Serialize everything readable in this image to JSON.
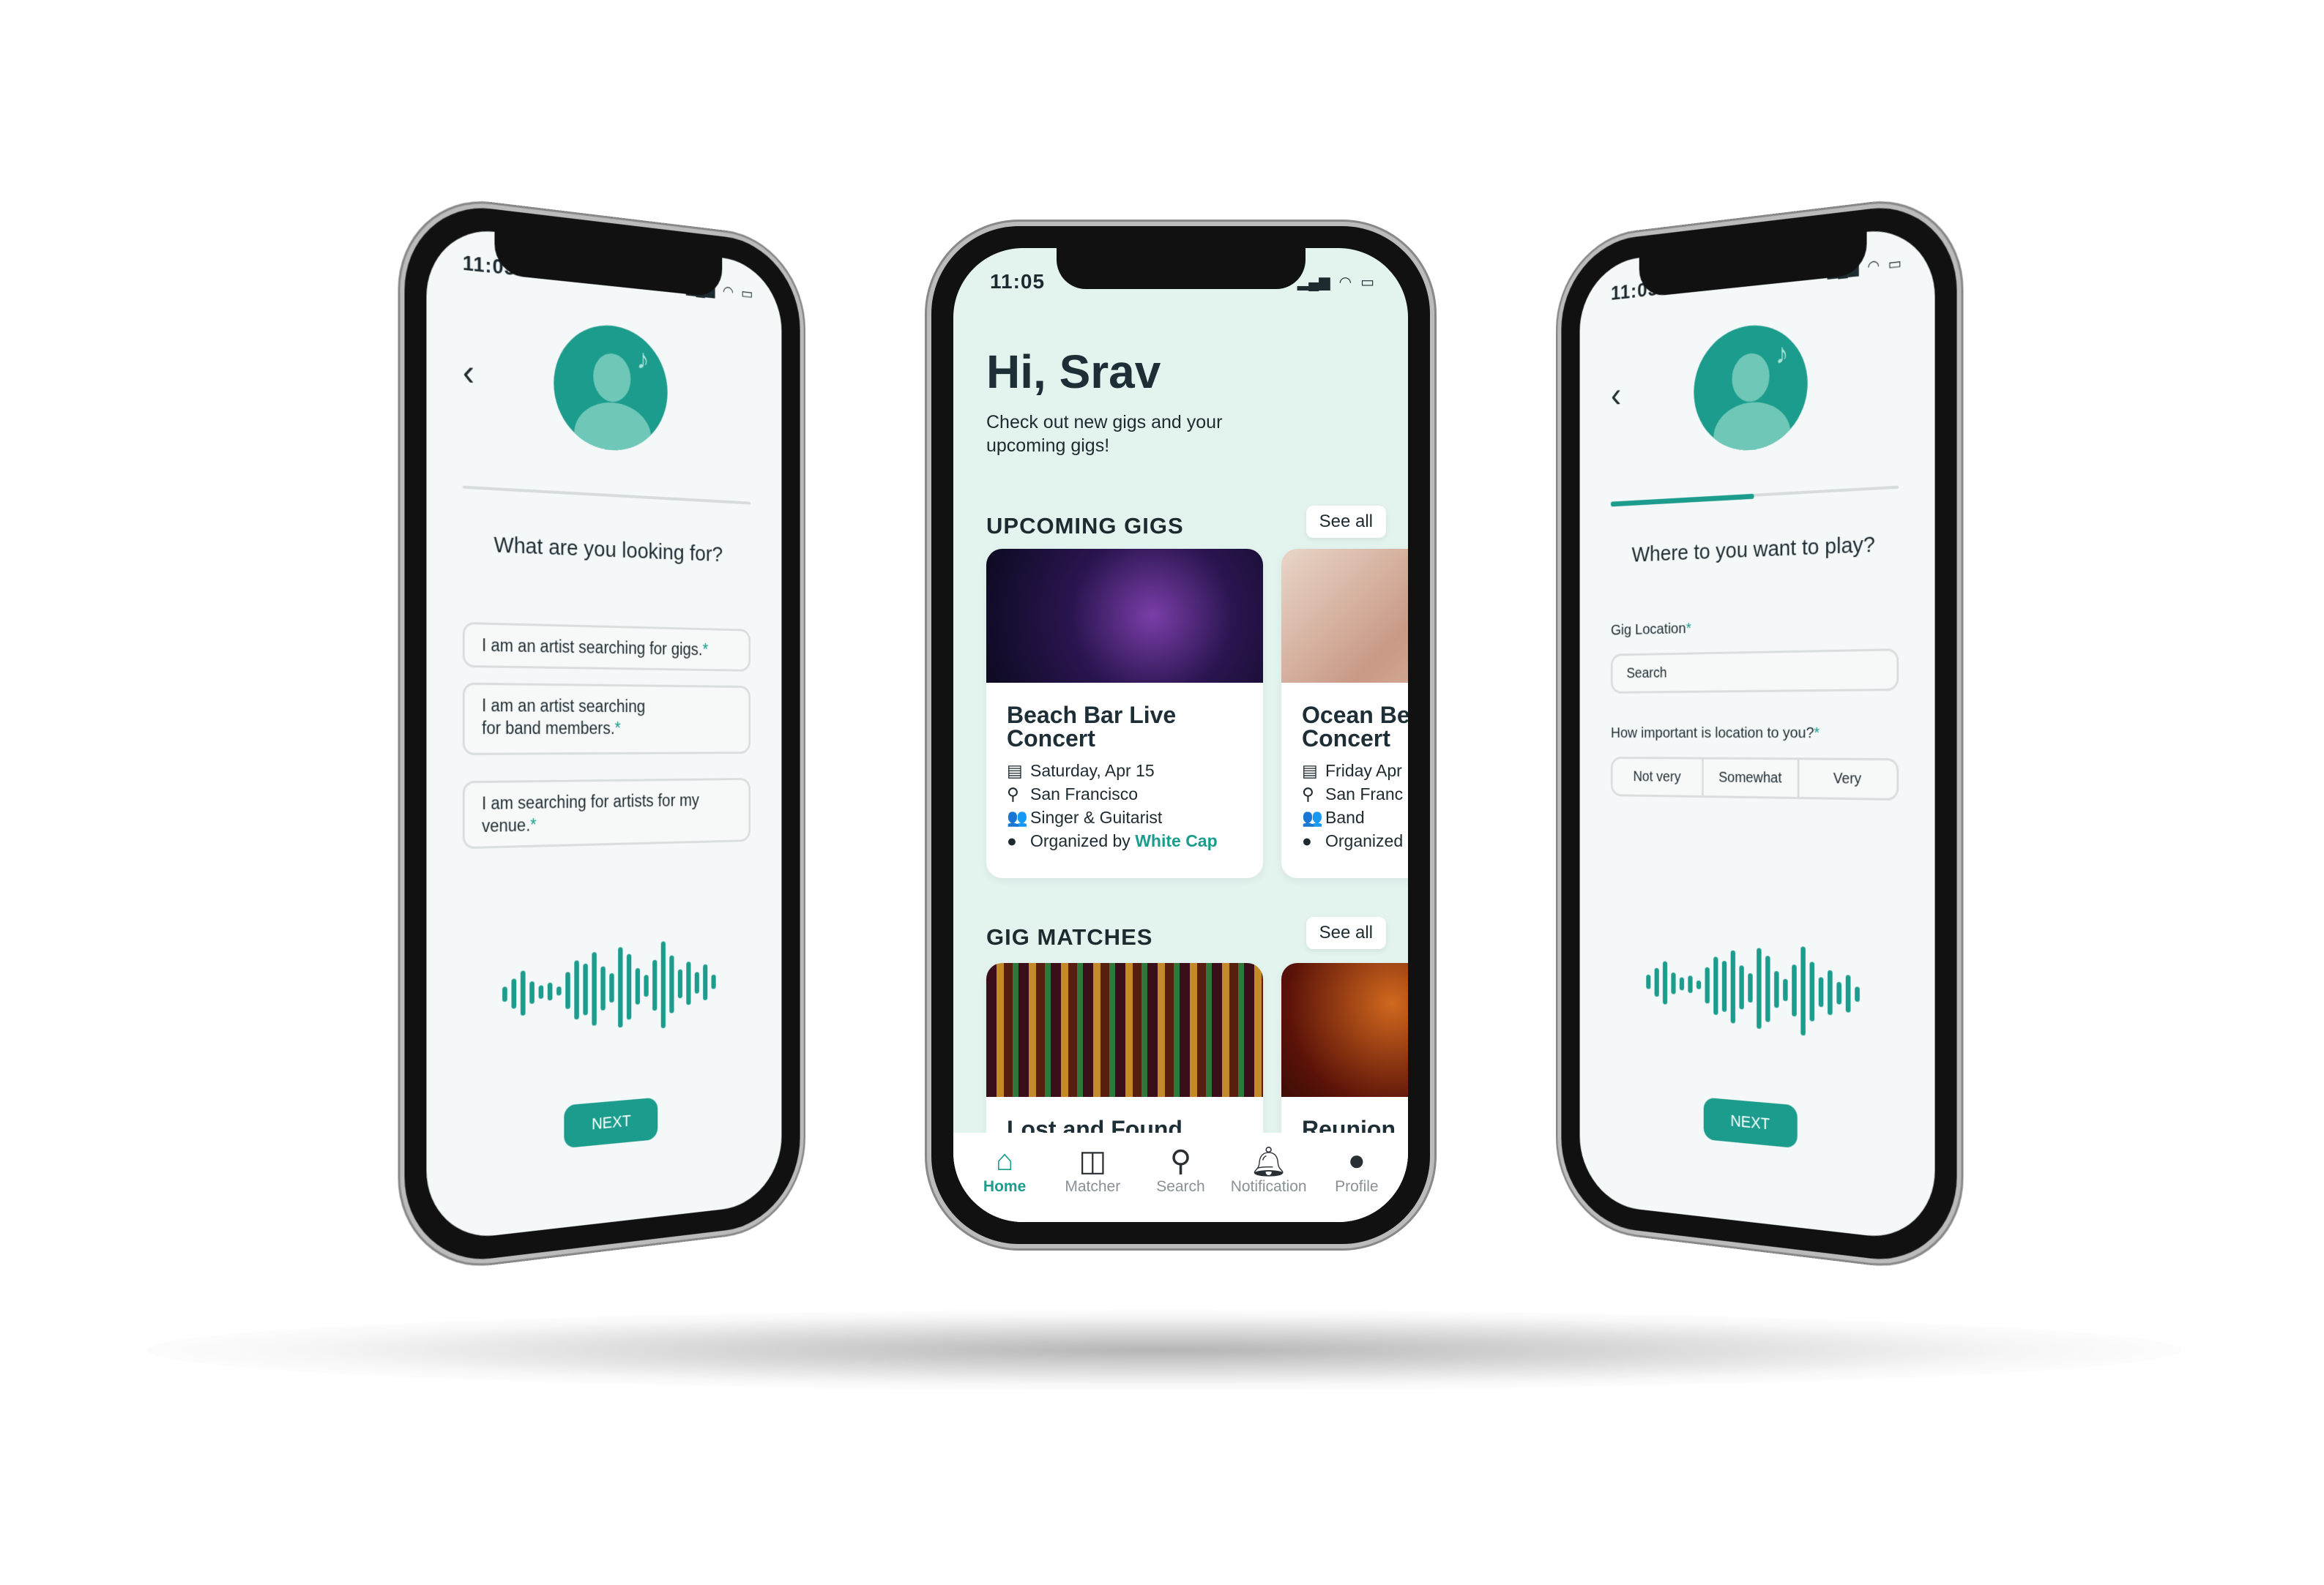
{
  "accent": "#1b9c8c",
  "status": {
    "time": "11:05",
    "icons": [
      "signal-icon",
      "wifi-icon",
      "battery-icon"
    ]
  },
  "left": {
    "question": "What are you looking for?",
    "options": [
      "I am an artist searching for gigs.",
      "I am an artist searching for band members.",
      "I am searching for artists for my venue."
    ],
    "required_mark": "*",
    "next": "NEXT"
  },
  "right": {
    "question": "Where to you want to play?",
    "progress_percent": 45,
    "location_label": "Gig Location",
    "location_placeholder": "Search",
    "importance_label": "How important is location to you?",
    "importance_options": [
      "Not very",
      "Somewhat",
      "Very"
    ],
    "required_mark": "*",
    "next": "NEXT"
  },
  "home": {
    "greeting": "Hi, Srav",
    "subtitle": "Check out new gigs and your upcoming gigs!",
    "upcoming_title": "UPCOMING GIGS",
    "see_all": "See all",
    "matches_title": "GIG MATCHES",
    "upcoming": [
      {
        "title": "Beach Bar Live Concert",
        "date": "Saturday, Apr 15",
        "location": "San Francisco",
        "role": "Singer & Guitarist",
        "organized_prefix": "Organized by",
        "organizer": "White Cap"
      },
      {
        "title": "Ocean Beach Concert",
        "date": "Friday Apr",
        "location": "San Franc",
        "role": "Band",
        "organized_prefix": "Organized"
      }
    ],
    "matches": [
      {
        "title": "Lost and Found"
      },
      {
        "title": "Reunion"
      }
    ],
    "nav": [
      {
        "label": "Home",
        "icon": "home-icon",
        "active": true
      },
      {
        "label": "Matcher",
        "icon": "matcher-icon"
      },
      {
        "label": "Search",
        "icon": "search-icon"
      },
      {
        "label": "Notification",
        "icon": "bell-icon"
      },
      {
        "label": "Profile",
        "icon": "profile-icon"
      }
    ]
  }
}
